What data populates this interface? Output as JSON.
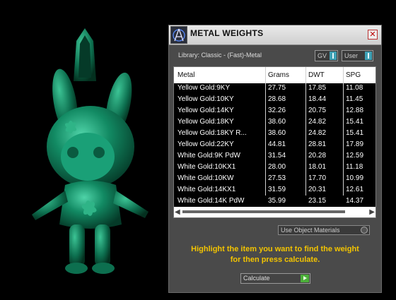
{
  "window": {
    "title": "METAL WEIGHTS",
    "logo_icon": "jewelry-cad-logo-icon",
    "close_icon": "close-icon"
  },
  "library_label": "Library: Classic - (Fast)-Metal",
  "toggles": {
    "gv_label": "GV",
    "user_label": "User"
  },
  "table": {
    "headers": [
      "Metal",
      "Grams",
      "DWT",
      "SPG"
    ],
    "rows": [
      [
        "Yellow Gold:9KY",
        "27.75",
        "17.85",
        "11.08"
      ],
      [
        "Yellow Gold:10KY",
        "28.68",
        "18.44",
        "11.45"
      ],
      [
        "Yellow Gold:14KY",
        "32.26",
        "20.75",
        "12.88"
      ],
      [
        "Yellow Gold:18KY",
        "38.60",
        "24.82",
        "15.41"
      ],
      [
        "Yellow Gold:18KY R...",
        "38.60",
        "24.82",
        "15.41"
      ],
      [
        "Yellow Gold:22KY",
        "44.81",
        "28.81",
        "17.89"
      ],
      [
        "White Gold:9K PdW",
        "31.54",
        "20.28",
        "12.59"
      ],
      [
        "White Gold:10KX1",
        "28.00",
        "18.01",
        "11.18"
      ],
      [
        "White Gold:10KW",
        "27.53",
        "17.70",
        "10.99"
      ],
      [
        "White Gold:14KX1",
        "31.59",
        "20.31",
        "12.61"
      ],
      [
        "White Gold:14K PdW",
        "35.99",
        "23.15",
        "14.37"
      ]
    ]
  },
  "use_object_materials_label": "Use Object Materials",
  "instruction": {
    "line1": "Highlight the item you want to find the weight",
    "line2": "for then press calculate."
  },
  "calculate_label": "Calculate",
  "colors": {
    "model": "#0f7a5c",
    "highlight_text": "#f3c400",
    "toggle_accent": "#3fa0b4",
    "go_green": "#4caf3a"
  }
}
